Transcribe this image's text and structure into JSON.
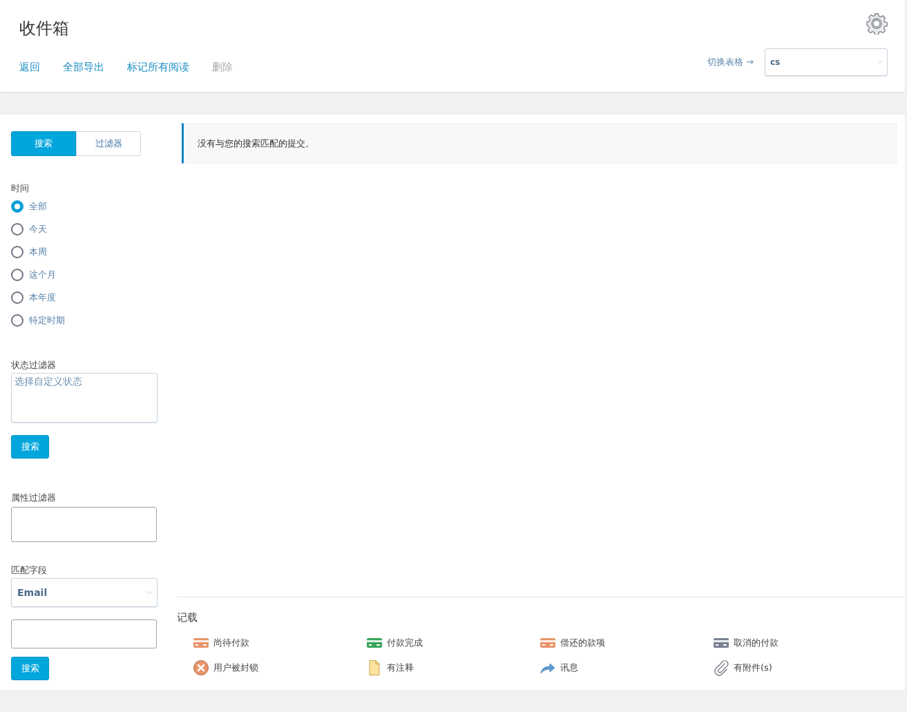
{
  "header": {
    "title": "收件箱",
    "actions": [
      {
        "label": "返回",
        "disabled": false
      },
      {
        "label": "全部导出",
        "disabled": false
      },
      {
        "label": "标记所有阅读",
        "disabled": false
      },
      {
        "label": "删除",
        "disabled": true
      }
    ],
    "switch_link": "切换表格 →",
    "form_select": {
      "value": "cs"
    }
  },
  "sidebar": {
    "tabs": [
      {
        "label": "搜索",
        "selected": true
      },
      {
        "label": "过滤器",
        "selected": false
      }
    ],
    "time": {
      "label": "时间",
      "options": [
        {
          "label": "全部",
          "selected": true
        },
        {
          "label": "今天",
          "selected": false
        },
        {
          "label": "本周",
          "selected": false
        },
        {
          "label": "这个月",
          "selected": false
        },
        {
          "label": "本年度",
          "selected": false
        },
        {
          "label": "特定时期",
          "selected": false
        }
      ]
    },
    "status_filter": {
      "label": "状态过滤器",
      "placeholder": "选择自定义状态"
    },
    "search_button_1": "搜索",
    "attribute_filter": {
      "label": "属性过滤器"
    },
    "match_field": {
      "label": "匹配字段",
      "value": "Email"
    },
    "search_button_2": "搜索"
  },
  "notice": "没有与您的搜索匹配的提交。",
  "legend": {
    "title": "记载",
    "items": [
      {
        "kind": "card",
        "color": "#e8956a",
        "label": "尚待付款"
      },
      {
        "kind": "card",
        "color": "#3aa55a",
        "label": "付款完成"
      },
      {
        "kind": "card",
        "color": "#e8956a",
        "label": "偿还的款项"
      },
      {
        "kind": "card",
        "color": "#7a8193",
        "label": "取消的付款"
      },
      {
        "kind": "blocked",
        "label": "用户被封锁"
      },
      {
        "kind": "note",
        "label": "有注释"
      },
      {
        "kind": "message",
        "label": "讯息"
      },
      {
        "kind": "attachment",
        "label": "有附件(s)"
      }
    ]
  }
}
